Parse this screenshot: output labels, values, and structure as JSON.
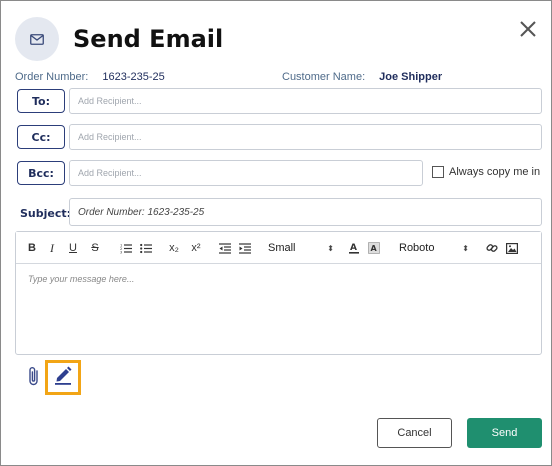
{
  "dialog": {
    "title": "Send Email",
    "icons": {
      "header": "envelope-icon",
      "close": "close-icon"
    }
  },
  "meta": {
    "order_label": "Order Number:",
    "order_value": "1623-235-25",
    "customer_label": "Customer Name:",
    "customer_value": "Joe Shipper"
  },
  "recipients": {
    "to_label": "To:",
    "cc_label": "Cc:",
    "bcc_label": "Bcc:",
    "placeholder": "Add Recipient...",
    "always_copy_label": "Always copy me in",
    "always_copy_checked": false
  },
  "subject": {
    "label": "Subject:",
    "value": "Order Number: 1623-235-25"
  },
  "editor": {
    "toolbar": {
      "bold": "B",
      "italic": "I",
      "underline": "U",
      "strike": "S",
      "subscript": "x₂",
      "superscript": "x²",
      "size_value": "Small",
      "font_value": "Roboto"
    },
    "placeholder": "Type your message here..."
  },
  "actions": {
    "cancel_label": "Cancel",
    "send_label": "Send"
  },
  "colors": {
    "accent": "#1f8f6f",
    "navy": "#1f2d5c",
    "highlight": "#f2a516"
  }
}
